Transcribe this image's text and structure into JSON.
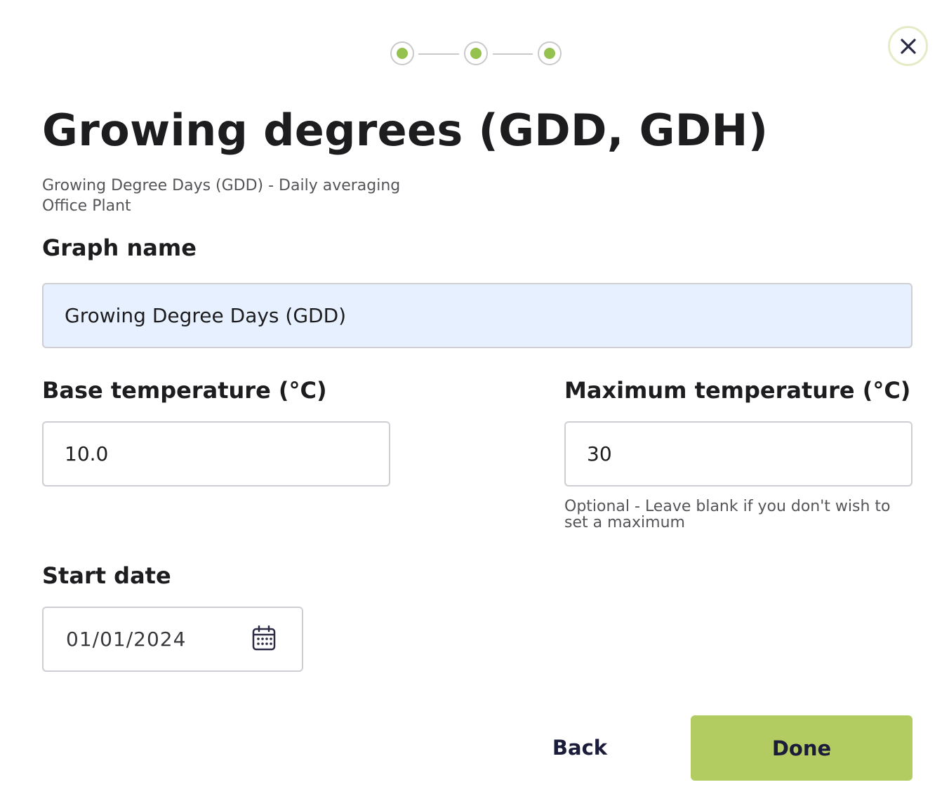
{
  "colors": {
    "accent": "#b3cc62",
    "step_dot": "#95c14f",
    "input_fill": "#e7f0fe",
    "text_dark": "#1d1d20",
    "button_text": "#1b1b3a"
  },
  "stepper": {
    "total_steps": 3,
    "completed_steps": 3
  },
  "close": {
    "icon": "close-icon"
  },
  "header": {
    "title": "Growing degrees (GDD, GDH)",
    "subtitle_line1": "Growing Degree Days (GDD) - Daily averaging",
    "subtitle_line2": "Office Plant"
  },
  "form": {
    "graph_name": {
      "label": "Graph name",
      "value": "Growing Degree Days (GDD)"
    },
    "base_temperature": {
      "label": "Base temperature (°C)",
      "value": "10.0"
    },
    "maximum_temperature": {
      "label": "Maximum temperature (°C)",
      "value": "30",
      "helper": "Optional - Leave blank if you don't wish to set a maximum"
    },
    "start_date": {
      "label": "Start date",
      "value": "01/01/2024",
      "icon": "calendar-icon"
    }
  },
  "actions": {
    "back_label": "Back",
    "done_label": "Done"
  }
}
